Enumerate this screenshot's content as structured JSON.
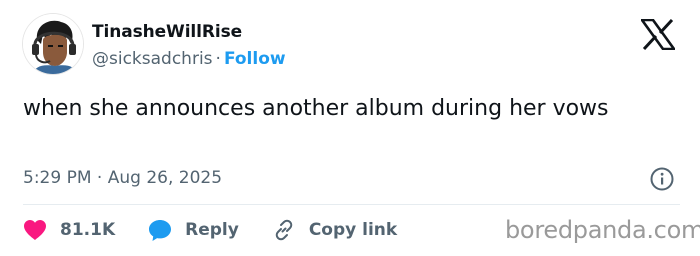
{
  "tweet": {
    "author": {
      "display_name": "TinasheWillRise",
      "handle": "@sicksadchris",
      "separator": "·",
      "follow_label": "Follow"
    },
    "text": "when she announces another album during her vows",
    "time": "5:29 PM",
    "date_separator": "·",
    "date": "Aug 26, 2025",
    "actions": {
      "likes": "81.1K",
      "reply_label": "Reply",
      "copy_link_label": "Copy link"
    }
  },
  "watermark": "boredpanda.com",
  "icons": {
    "logo": "x-logo-icon",
    "info": "info-icon",
    "like": "heart-icon",
    "reply": "speech-bubble-icon",
    "copy": "link-icon"
  },
  "colors": {
    "text": "#0f1419",
    "secondary": "#536471",
    "accent": "#1d9bf0",
    "like": "#f91880",
    "watermark": "#9a9a9a"
  }
}
